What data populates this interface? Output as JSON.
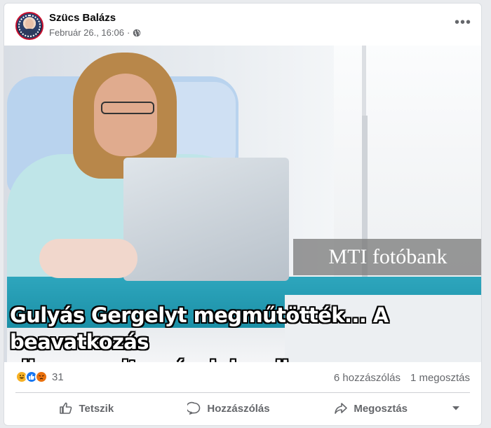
{
  "post": {
    "author": "Szücs Balázs",
    "timestamp": "Február 26., 16:06",
    "audience_icon": "globe-icon",
    "more_icon": "more-horizontal-icon"
  },
  "image": {
    "watermark": "MTI fotóbank",
    "caption_line1": "Gulyás Gergelyt megműtötték... A beavatkozás",
    "caption_line2": "sikeres volt, már dolgozik.."
  },
  "stats": {
    "reaction_icons": [
      "haha-icon",
      "like-icon",
      "angry-icon"
    ],
    "reaction_count": "31",
    "comments": "6 hozzászólás",
    "shares": "1 megosztás"
  },
  "actions": {
    "like_label": "Tetszik",
    "comment_label": "Hozzászólás",
    "share_label": "Megosztás"
  },
  "colors": {
    "like_blue": "#1877f2",
    "haha_yellow": "#f7b125",
    "angry_orange": "#e9710f",
    "secondary_text": "#65676b"
  }
}
